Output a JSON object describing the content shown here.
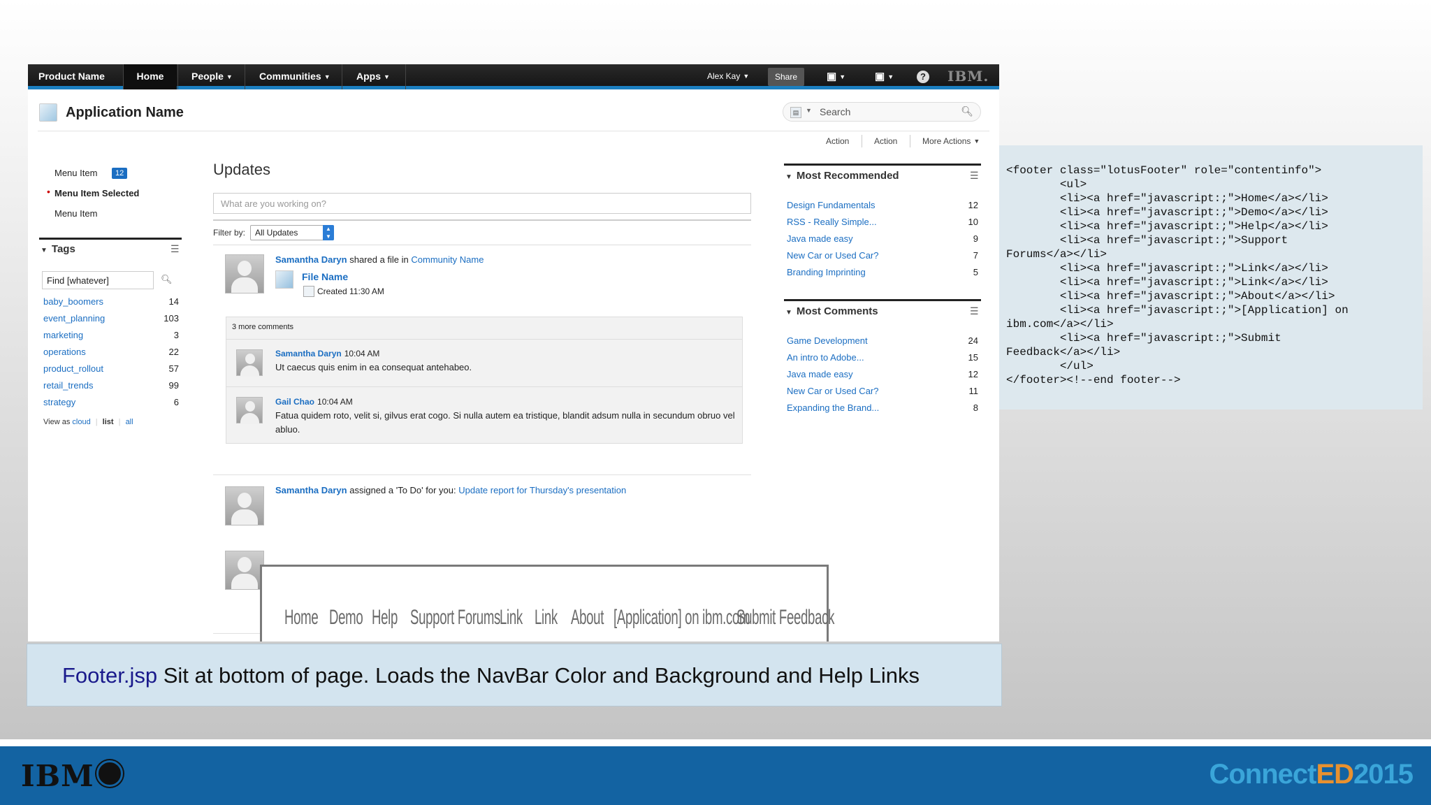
{
  "navbar": {
    "brand": "Product Name",
    "home": "Home",
    "people": "People",
    "communities": "Communities",
    "apps": "Apps",
    "user": "Alex Kay",
    "share": "Share",
    "ibm": "IBM."
  },
  "header": {
    "app_title": "Application Name",
    "search_placeholder": "Search",
    "actions": [
      "Action",
      "Action",
      "More Actions"
    ]
  },
  "sidebar": {
    "menu_items": [
      {
        "label": "Menu Item",
        "badge": "12"
      },
      {
        "label": "Menu Item Selected"
      },
      {
        "label": "Menu Item"
      }
    ],
    "tags_title": "Tags",
    "tags_input": "Find [whatever]",
    "tags": [
      {
        "name": "baby_boomers",
        "count": "14"
      },
      {
        "name": "event_planning",
        "count": "103"
      },
      {
        "name": "marketing",
        "count": "3"
      },
      {
        "name": "operations",
        "count": "22"
      },
      {
        "name": "product_rollout",
        "count": "57"
      },
      {
        "name": "retail_trends",
        "count": "99"
      },
      {
        "name": "strategy",
        "count": "6"
      }
    ],
    "view_as_label": "View as",
    "view_cloud": "cloud",
    "view_list": "list",
    "view_all": "all"
  },
  "main": {
    "title": "Updates",
    "status_placeholder": "What are you working on?",
    "filter_label": "Filter by:",
    "filter_value": "All Updates",
    "update1": {
      "author": "Samantha Daryn",
      "action": "shared a file in",
      "community": "Community Name",
      "file_name": "File Name",
      "created": "Created 11:30 AM"
    },
    "more_comments": "3 more comments",
    "comments": [
      {
        "author": "Samantha Daryn",
        "time": "10:04 AM",
        "text": "Ut caecus quis enim in ea consequat antehabeo."
      },
      {
        "author": "Gail Chao",
        "time": "10:04 AM",
        "text": "Fatua quidem roto, velit si, gilvus erat cogo. Si nulla autem ea tristique, blandit adsum nulla in secundum obruo vel abluo."
      }
    ],
    "update2": {
      "author": "Samantha Daryn",
      "action": "assigned a 'To Do' for you:",
      "link": "Update report for Thursday's presentation"
    }
  },
  "right": {
    "most_recommended_title": "Most Recommended",
    "most_recommended": [
      {
        "name": "Design Fundamentals",
        "count": "12"
      },
      {
        "name": "RSS - Really Simple...",
        "count": "10"
      },
      {
        "name": "Java made easy",
        "count": "9"
      },
      {
        "name": "New Car or Used Car?",
        "count": "7"
      },
      {
        "name": "Branding Imprinting",
        "count": "5"
      }
    ],
    "most_comments_title": "Most Comments",
    "most_comments": [
      {
        "name": "Game Development",
        "count": "24"
      },
      {
        "name": "An intro to Adobe...",
        "count": "15"
      },
      {
        "name": "Java made easy",
        "count": "12"
      },
      {
        "name": "New Car or Used Car?",
        "count": "11"
      },
      {
        "name": "Expanding the Brand...",
        "count": "8"
      }
    ]
  },
  "footer_links": [
    "Home",
    "Demo",
    "Help",
    "Support Forums",
    "Link",
    "Link",
    "About",
    "[Application] on ibm.com",
    "Submit Feedback"
  ],
  "code": "<footer class=\"lotusFooter\" role=\"contentinfo\">\n        <ul>\n        <li><a href=\"javascript:;\">Home</a></li>\n        <li><a href=\"javascript:;\">Demo</a></li>\n        <li><a href=\"javascript:;\">Help</a></li>\n        <li><a href=\"javascript:;\">Support\nForums</a></li>\n        <li><a href=\"javascript:;\">Link</a></li>\n        <li><a href=\"javascript:;\">Link</a></li>\n        <li><a href=\"javascript:;\">About</a></li>\n        <li><a href=\"javascript:;\">[Application] on\nibm.com</a></li>\n        <li><a href=\"javascript:;\">Submit\nFeedback</a></li>\n        </ul>\n</footer><!--end footer-->",
  "caption": {
    "link": "Footer.jsp",
    "text": " Sit at bottom of page.  Loads the NavBar Color and Background and Help Links"
  },
  "bottom_bar": {
    "ibm_logo": "IBM",
    "brand_prefix": "Connect",
    "brand_highlight": "ED",
    "brand_year": "2015"
  },
  "colors": {
    "accent": "#1b7fc0",
    "link": "#1b6ec2",
    "footer_bar": "#1363a2",
    "caption_bg": "#d3e4ef",
    "code_bg": "#dde8ee"
  }
}
